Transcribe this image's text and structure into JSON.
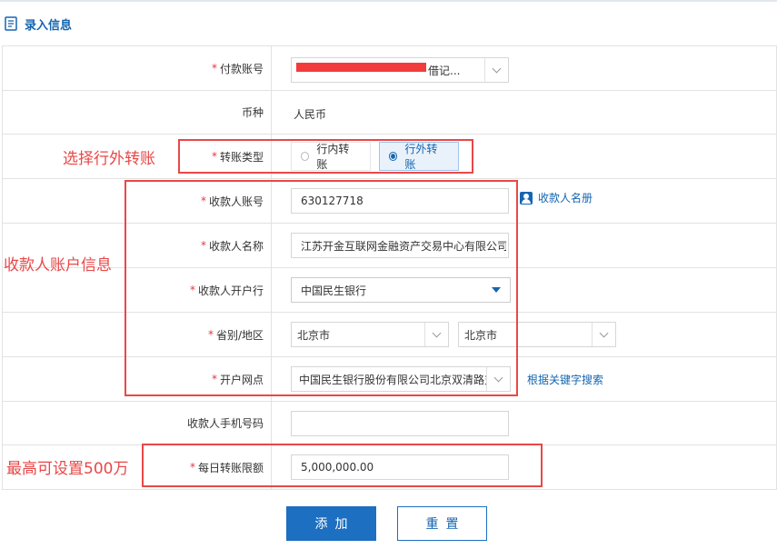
{
  "header": {
    "title": "录入信息"
  },
  "fields": {
    "payer_account": {
      "label": "付款账号",
      "required": true,
      "value_suffix": "借记..."
    },
    "currency": {
      "label": "币种",
      "required": false,
      "value": "人民币"
    },
    "transfer_type": {
      "label": "转账类型",
      "required": true,
      "options": [
        "行内转账",
        "行外转账"
      ],
      "selected": "行外转账"
    },
    "payee_account": {
      "label": "收款人账号",
      "required": true,
      "value": "630127718",
      "link": "收款人名册"
    },
    "payee_name": {
      "label": "收款人名称",
      "required": true,
      "value": "江苏开金互联网金融资产交易中心有限公司"
    },
    "payee_bank": {
      "label": "收款人开户行",
      "required": true,
      "value": "中国民生银行"
    },
    "region": {
      "label": "省别/地区",
      "required": true,
      "province": "北京市",
      "city": "北京市"
    },
    "branch": {
      "label": "开户网点",
      "required": true,
      "value": "中国民生银行股份有限公司北京双清路支行",
      "link": "根据关键字搜索"
    },
    "payee_phone": {
      "label": "收款人手机号码",
      "required": false,
      "value": ""
    },
    "daily_limit": {
      "label": "每日转账限额",
      "required": true,
      "value": "5,000,000.00"
    }
  },
  "annotations": {
    "transfer_type": "选择行外转账",
    "payee_info": "收款人账户信息",
    "limit": "最高可设置500万"
  },
  "buttons": {
    "add": "添加",
    "reset": "重置"
  },
  "colors": {
    "accent": "#1565b0",
    "required_star": "#e0393e",
    "annotation": "#e84848",
    "redaction": "#f23c3c"
  }
}
